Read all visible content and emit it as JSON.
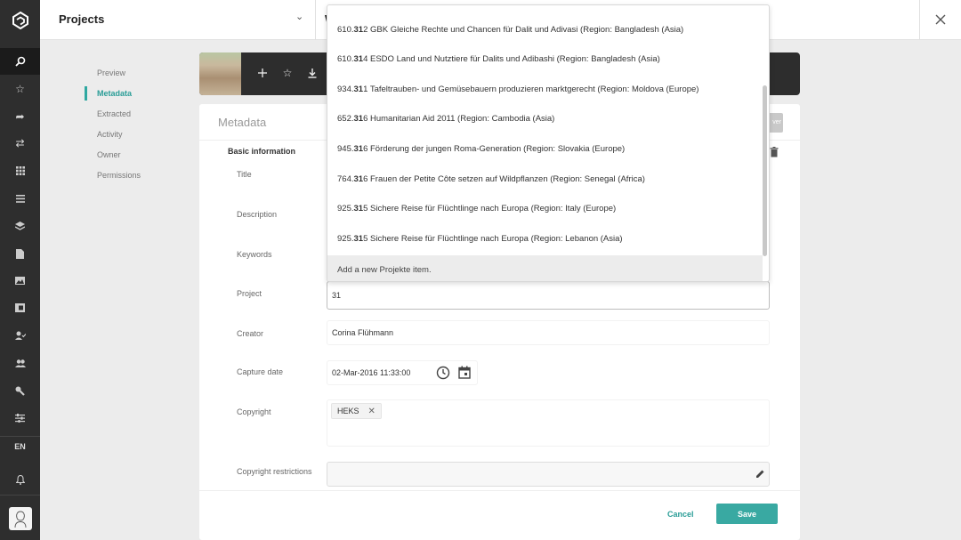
{
  "app": {
    "language": "EN",
    "nav_icons": [
      "search-icon",
      "star-icon",
      "share-icon",
      "transfer-icon",
      "grid-icon",
      "list-icon",
      "layers-icon",
      "document-icon",
      "image-icon",
      "collection-icon",
      "user-check-icon",
      "users-icon",
      "wrench-icon",
      "sliders-icon",
      "bell-icon"
    ]
  },
  "header": {
    "title": "Projects",
    "tab_partial": "W"
  },
  "subnav": {
    "items": [
      "Preview",
      "Metadata",
      "Extracted",
      "Activity",
      "Owner",
      "Permissions"
    ],
    "active": "Metadata"
  },
  "panel": {
    "title": "Metadata",
    "save_partial": "ver",
    "section": "Basic information",
    "labels": {
      "title": "Title",
      "description": "Description",
      "keywords": "Keywords",
      "project": "Project",
      "creator": "Creator",
      "capture_date": "Capture date",
      "copyright": "Copyright",
      "copyright_restrictions": "Copyright restrictions"
    },
    "values": {
      "project": "31",
      "creator": "Corina Flühmann",
      "capture_date": "02-Mar-2016 11:33:00",
      "copyright_chip": "HEKS"
    },
    "cancel": "Cancel",
    "save": "Save"
  },
  "dropdown": {
    "items": [
      {
        "pre": "610.",
        "match": "31",
        "post": "2 GBK Gleiche Rechte und Chancen für Dalit und Adivasi (Region: Bangladesh (Asia)"
      },
      {
        "pre": "610.",
        "match": "31",
        "post": "4 ESDO Land und Nutztiere für Dalits und Adibashi (Region: Bangladesh (Asia)"
      },
      {
        "pre": "934.",
        "match": "31",
        "post": "1 Tafeltrauben- und Gemüsebauern produzieren marktgerecht (Region: Moldova (Europe)"
      },
      {
        "pre": "652.",
        "match": "31",
        "post": "6 Humanitarian Aid 2011 (Region: Cambodia (Asia)"
      },
      {
        "pre": "945.",
        "match": "31",
        "post": "6 Förderung der jungen Roma-Generation (Region: Slovakia (Europe)"
      },
      {
        "pre": "764.",
        "match": "31",
        "post": "6 Frauen der Petite Côte setzen auf Wildpflanzen (Region: Senegal (Africa)"
      },
      {
        "pre": "925.",
        "match": "31",
        "post": "5 Sichere Reise für Flüchtlinge nach Europa (Region: Italy (Europe)"
      },
      {
        "pre": "925.",
        "match": "31",
        "post": "5 Sichere Reise für Flüchtlinge nach Europa (Region: Lebanon (Asia)"
      }
    ],
    "add_label": "Add a new Projekte item."
  }
}
